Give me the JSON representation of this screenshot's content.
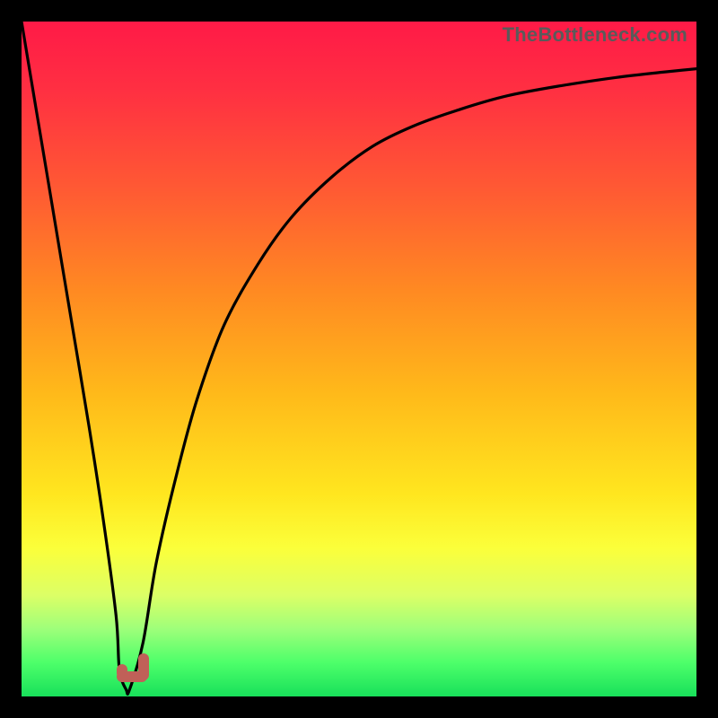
{
  "watermark": "TheBottleneck.com",
  "colors": {
    "frame": "#000000",
    "watermark_text": "#5a5a5a",
    "curve": "#000000",
    "marker": "#c06058",
    "gradient_stops": [
      {
        "pos": 0.0,
        "hex": "#ff1a47"
      },
      {
        "pos": 0.1,
        "hex": "#ff2f42"
      },
      {
        "pos": 0.25,
        "hex": "#ff5a33"
      },
      {
        "pos": 0.4,
        "hex": "#ff8a22"
      },
      {
        "pos": 0.55,
        "hex": "#ffb91a"
      },
      {
        "pos": 0.7,
        "hex": "#ffe61f"
      },
      {
        "pos": 0.78,
        "hex": "#fbff3a"
      },
      {
        "pos": 0.85,
        "hex": "#dcff66"
      },
      {
        "pos": 0.9,
        "hex": "#9eff7a"
      },
      {
        "pos": 0.95,
        "hex": "#4dff6a"
      },
      {
        "pos": 1.0,
        "hex": "#18e05a"
      }
    ]
  },
  "chart_data": {
    "type": "line",
    "title": "",
    "xlabel": "",
    "ylabel": "",
    "xlim": [
      0,
      100
    ],
    "ylim": [
      0,
      100
    ],
    "grid": false,
    "legend": "none",
    "series": [
      {
        "name": "bottleneck-curve",
        "x": [
          0,
          2,
          4,
          6,
          8,
          10,
          12,
          14,
          14.5,
          15.5,
          16,
          18,
          20,
          23,
          26,
          30,
          35,
          40,
          46,
          52,
          58,
          65,
          72,
          80,
          88,
          95,
          100
        ],
        "y": [
          100,
          88,
          76,
          64,
          52,
          40,
          27,
          12,
          4,
          1,
          1,
          8,
          20,
          33,
          44,
          55,
          64,
          71,
          77,
          81.5,
          84.5,
          87,
          89,
          90.5,
          91.7,
          92.5,
          93
        ]
      }
    ],
    "annotations": [
      {
        "name": "min-marker",
        "shape": "J",
        "x_range": [
          14,
          17
        ],
        "y_range": [
          0,
          3
        ]
      }
    ],
    "notes": "Axes have no visible tick labels or numeric annotations in the image; values above are proportional estimates on a 0–100 scale read from pixel positions."
  }
}
